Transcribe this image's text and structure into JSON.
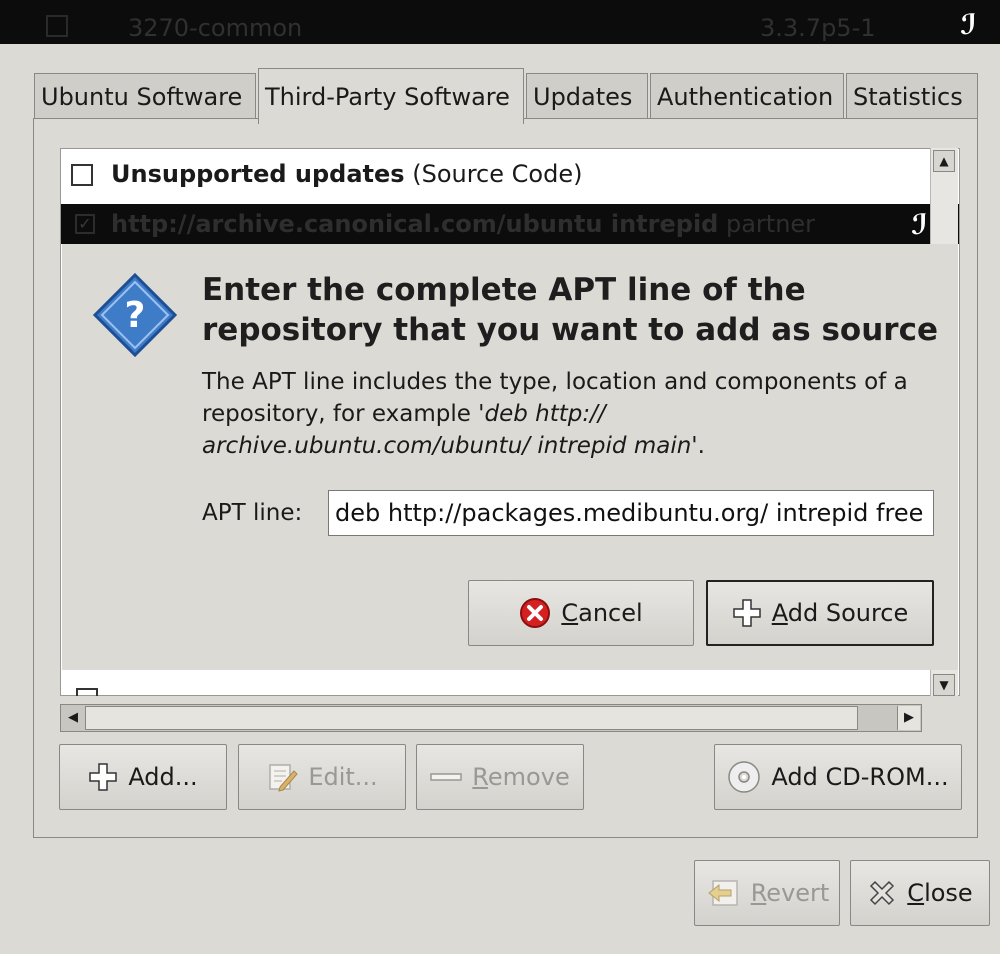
{
  "top_row": {
    "name": "3270-common",
    "version": "3.3.7p5-1",
    "logo": "ℐ"
  },
  "tabs": [
    {
      "label": "Ubuntu Software",
      "active": false
    },
    {
      "label": "Third-Party Software",
      "active": true
    },
    {
      "label": "Updates",
      "active": false
    },
    {
      "label": "Authentication",
      "active": false
    },
    {
      "label": "Statistics",
      "active": false
    }
  ],
  "sources": {
    "row1": {
      "bold": "Unsupported updates",
      "rest": " (Source Code)",
      "checked": false
    },
    "row2": {
      "bold": "http://archive.canonical.com/ubuntu intrepid",
      "rest": " partner",
      "checked": true
    }
  },
  "dialog": {
    "icon": "question-icon",
    "title": "Enter the complete APT line of the repository that you want to add as source",
    "desc_plain": "The APT line includes the type, location and components of a repository, for example ",
    "desc_example": "'deb http:// archive.ubuntu.com/ubuntu/ intrepid main'",
    "desc_end": ".",
    "apt_label": "APT line:",
    "apt_value": "deb http://packages.medibuntu.org/ intrepid free",
    "cancel_label": "Cancel",
    "cancel_mnemonic": "C",
    "cancel_rest": "ancel",
    "add_source_mnemonic": "A",
    "add_source_rest": "dd Source"
  },
  "buttons": {
    "add": "Add...",
    "edit": "Edit...",
    "remove_mnemonic": "R",
    "remove_rest": "emove",
    "add_cdrom": "Add CD-ROM...",
    "revert_mnemonic": "R",
    "revert_rest": "evert",
    "close_mnemonic": "C",
    "close_rest": "lose"
  },
  "colors": {
    "window_bg": "#dcdad5",
    "error_red": "#d42020",
    "question_blue": "#3f7cc8"
  }
}
